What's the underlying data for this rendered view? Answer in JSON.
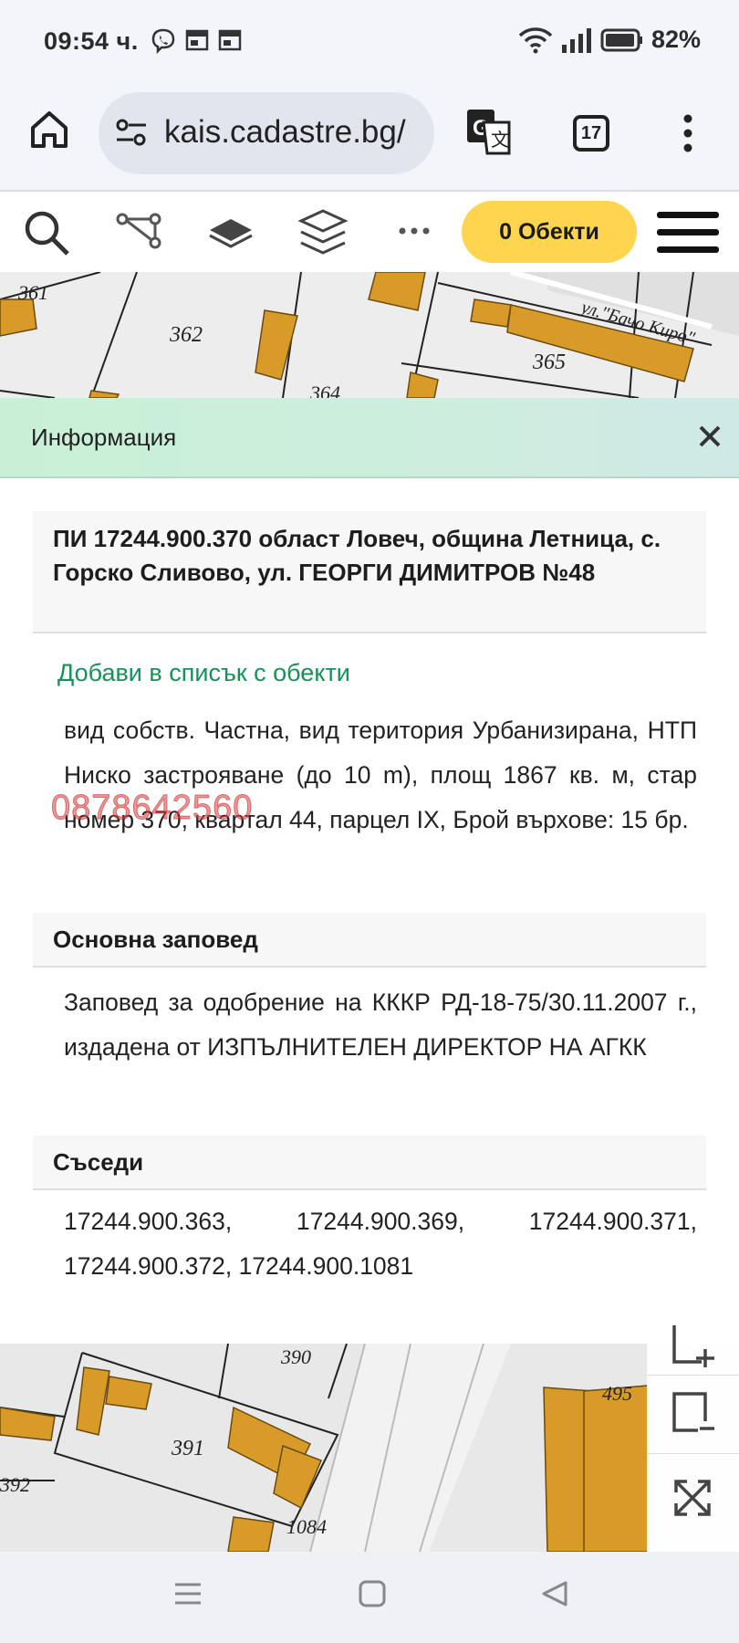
{
  "status_bar": {
    "time": "09:54 ч.",
    "battery": "82%"
  },
  "browser": {
    "url": "kais.cadastre.bg/",
    "tab_count": "17"
  },
  "toolbar": {
    "objects_button": "0 Обекти"
  },
  "map": {
    "top_labels": [
      "361",
      "362",
      "365",
      "364",
      "ул.\"Бачо Киро\""
    ],
    "bottom_labels": [
      "390",
      "391",
      "392",
      "1084",
      "495"
    ]
  },
  "info": {
    "title": "Информация",
    "property_title": "ПИ 17244.900.370 област Ловеч, община Летница, с. Горско Сливово, ул. ГЕОРГИ ДИМИТРОВ №48",
    "add_link": "Добави в списък с обекти",
    "description": "вид собств. Частна, вид територия Урбанизирана, НТП Ниско застрояване (до 10 m), площ 1867 кв. м, стар номер 370, квартал 44, парцел IX, Брой върхове: 15 бр.",
    "watermark": "0878642560",
    "order_heading": "Основна заповед",
    "order_text": "Заповед за одобрение на КККР РД-18-75/30.11.2007 г., издадена от ИЗПЪЛНИТЕЛЕН ДИРЕКТОР НА АГКК",
    "neighbors_heading": "Съседи",
    "neighbors_text": "17244.900.363, 17244.900.369, 17244.900.371, 17244.900.372, 17244.900.1081"
  },
  "colors": {
    "accent_yellow": "#ffd54f",
    "link_green": "#16915a",
    "building_orange": "#d89b28",
    "header_green": "#c9f0d6"
  },
  "icons": [
    "viber-icon",
    "calendar-icon",
    "wifi-icon",
    "signal-icon",
    "battery-icon",
    "home-icon",
    "site-settings-icon",
    "translate-icon",
    "tabs-icon",
    "more-vert-icon",
    "search-icon",
    "route-icon",
    "layer-icon",
    "layers-icon",
    "more-horiz-icon",
    "hamburger-icon",
    "close-icon",
    "zoom-in-area-icon",
    "zoom-out-area-icon",
    "fullscreen-icon",
    "nav-menu-icon",
    "nav-home-icon",
    "nav-back-icon"
  ]
}
